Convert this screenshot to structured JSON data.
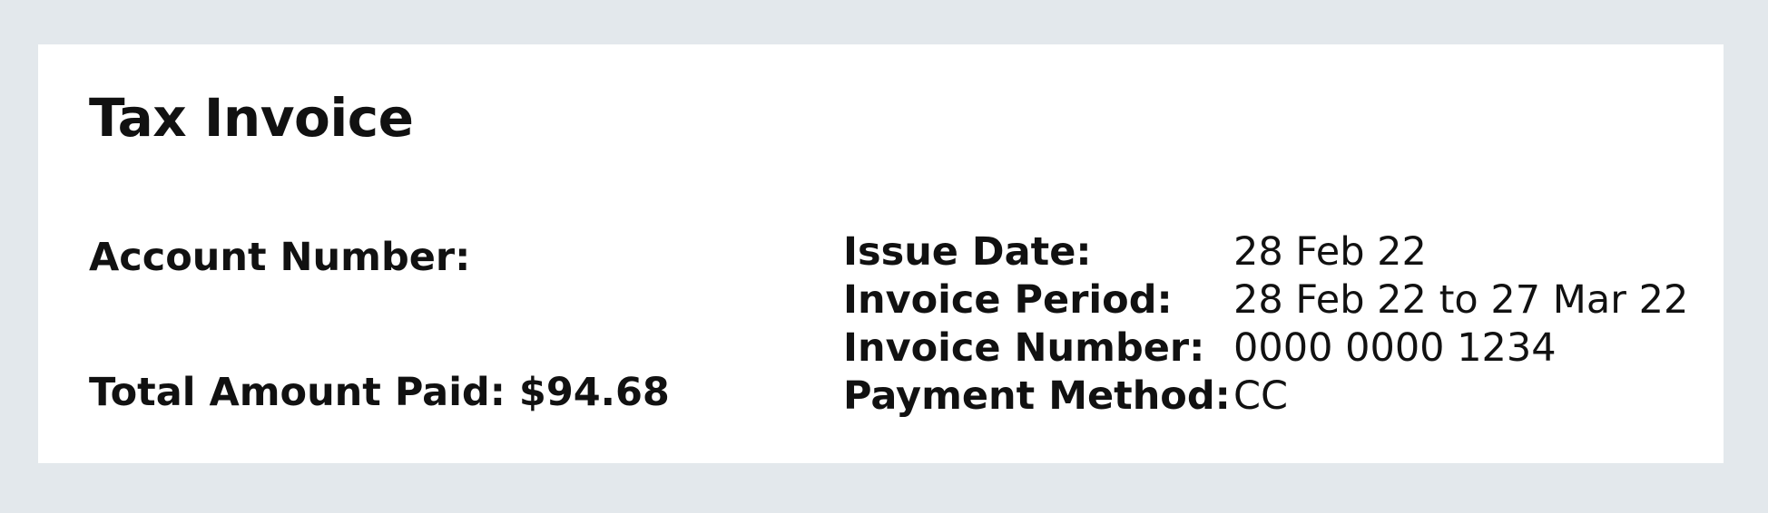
{
  "invoice": {
    "title": "Tax Invoice",
    "account_number_label": "Account Number:",
    "total_paid_label": "Total Amount Paid:",
    "total_paid_value": "$94.68",
    "details": [
      {
        "label": "Issue Date:",
        "value": "28 Feb 22"
      },
      {
        "label": "Invoice Period:",
        "value": "28 Feb 22 to 27 Mar 22"
      },
      {
        "label": "Invoice Number:",
        "value": "0000 0000 1234"
      },
      {
        "label": "Payment Method:",
        "value": "CC"
      }
    ]
  },
  "colors": {
    "page_background": "#e3e8ec",
    "card_background": "#ffffff",
    "text": "#111111"
  }
}
